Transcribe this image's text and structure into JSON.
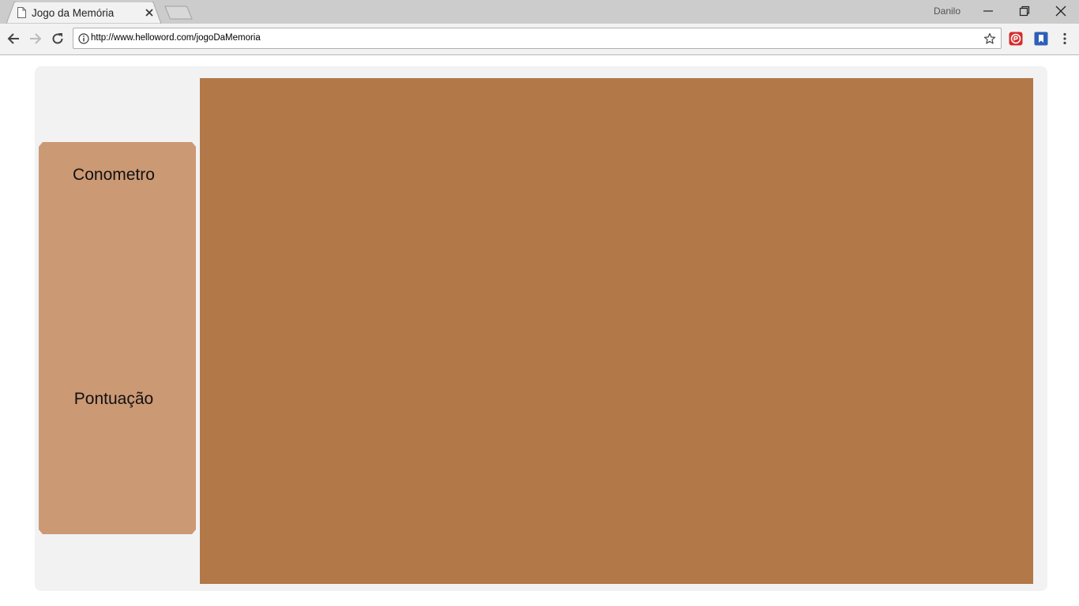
{
  "browser": {
    "tab_title": "Jogo da Memória",
    "profile_name": "Danilo",
    "url": "http://www.helloword.com/jogoDaMemoria"
  },
  "page": {
    "sidebar": {
      "timer_label": "Conometro",
      "score_label": "Pontuação"
    }
  },
  "colors": {
    "chrome_frame": "#cccccc",
    "toolbar": "#f2f2f2",
    "page_container": "#f2f2f2",
    "sidebar": "#cc9975",
    "board": "#b27848"
  },
  "icons": {
    "tab": "page-icon",
    "tab_close": "close-icon",
    "back": "arrow-left-icon",
    "forward": "arrow-right-icon",
    "reload": "reload-icon",
    "site_info": "info-icon",
    "bookmark": "star-icon",
    "extension_1": "extension-red-icon",
    "extension_2": "bookmark-extension-icon",
    "menu": "kebab-menu-icon"
  }
}
